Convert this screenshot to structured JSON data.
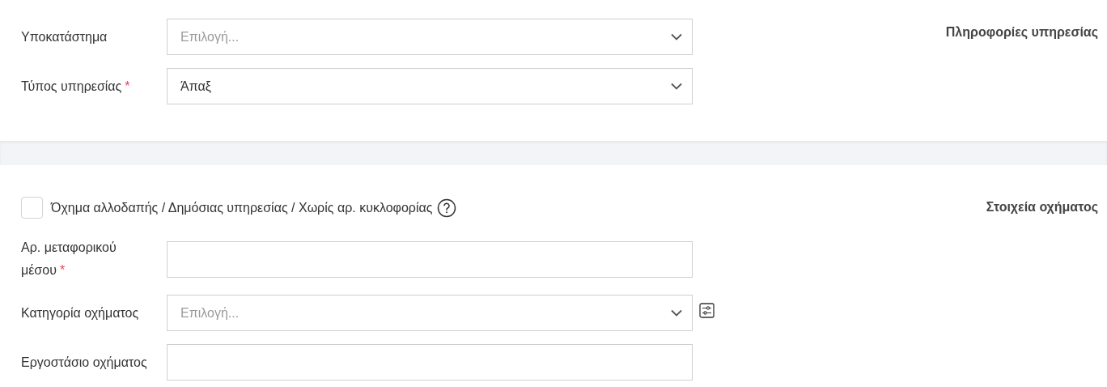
{
  "sections": [
    {
      "title": "Πληροφορίες υπηρεσίας",
      "fields": [
        {
          "kind": "select",
          "label": "Υποκατάστημα",
          "placeholder": "Επιλογή..."
        },
        {
          "kind": "select",
          "label": "Τύπος υπηρεσίας",
          "required_mark": "*",
          "value": "Άπαξ"
        }
      ]
    },
    {
      "title": "Στοιχεία οχήματος",
      "fields": [
        {
          "kind": "checkbox",
          "label": "Όχημα αλλοδαπής / Δημόσιας υπηρεσίας / Χωρίς αρ. κυκλοφορίας",
          "checked": false,
          "help": true
        },
        {
          "kind": "text",
          "label": "Αρ. μεταφορικού μέσου",
          "required_mark": "*"
        },
        {
          "kind": "select",
          "label": "Κατηγορία οχήματος",
          "placeholder": "Επιλογή...",
          "filter": true
        },
        {
          "kind": "text",
          "label": "Εργοστάσιο οχήματος"
        }
      ]
    }
  ]
}
